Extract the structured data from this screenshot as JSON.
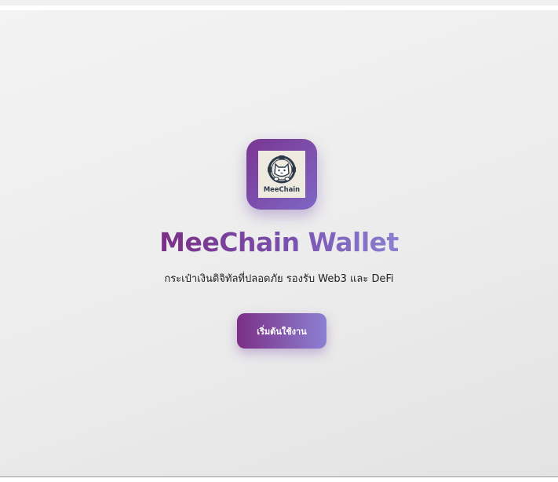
{
  "app": {
    "logo_text": "MeeChain",
    "title": "MeeChain Wallet",
    "subtitle": "กระเป๋าเงินดิจิทัลที่ปลอดภัย รองรับ Web3 และ DeFi"
  },
  "actions": {
    "start_label": "เริ่มต้นใช้งาน"
  },
  "colors": {
    "brand_purple": "#7b2f86",
    "brand_violet": "#8c80d2",
    "background": "#eeeeee"
  },
  "icons": {
    "logo": "meechain-cat-mascot-icon"
  }
}
